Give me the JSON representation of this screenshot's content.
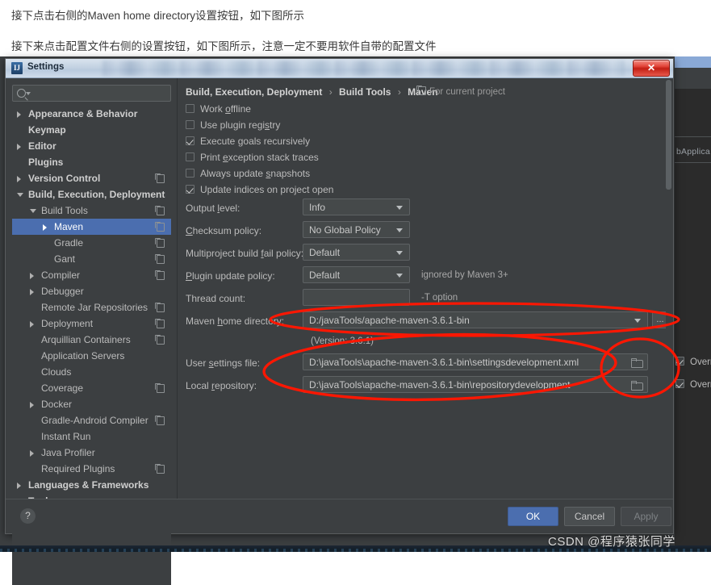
{
  "article": {
    "paragraphs": [
      "接下点击右侧的Maven home directory设置按钮，如下图所示",
      "接下来点击配置文件右侧的设置按钮，如下图所示，注意一定不要用软件自带的配置文件"
    ]
  },
  "window": {
    "title": "Settings",
    "app_icon": "IJ",
    "close_label": "✕"
  },
  "search": {
    "placeholder": "",
    "value": "",
    "icon": "search-icon"
  },
  "tree": {
    "items": [
      {
        "label": "Appearance & Behavior",
        "indent": 0,
        "arrow": "collapsed",
        "bold": true,
        "copy": false,
        "selected": false
      },
      {
        "label": "Keymap",
        "indent": 0,
        "arrow": "none",
        "bold": true,
        "copy": false,
        "selected": false
      },
      {
        "label": "Editor",
        "indent": 0,
        "arrow": "collapsed",
        "bold": true,
        "copy": false,
        "selected": false
      },
      {
        "label": "Plugins",
        "indent": 0,
        "arrow": "none",
        "bold": true,
        "copy": false,
        "selected": false
      },
      {
        "label": "Version Control",
        "indent": 0,
        "arrow": "collapsed",
        "bold": true,
        "copy": true,
        "selected": false
      },
      {
        "label": "Build, Execution, Deployment",
        "indent": 0,
        "arrow": "expanded",
        "bold": true,
        "copy": false,
        "selected": false
      },
      {
        "label": "Build Tools",
        "indent": 1,
        "arrow": "expanded",
        "bold": false,
        "copy": true,
        "selected": false
      },
      {
        "label": "Maven",
        "indent": 2,
        "arrow": "collapsed",
        "bold": false,
        "copy": true,
        "selected": true
      },
      {
        "label": "Gradle",
        "indent": 2,
        "arrow": "none",
        "bold": false,
        "copy": true,
        "selected": false
      },
      {
        "label": "Gant",
        "indent": 2,
        "arrow": "none",
        "bold": false,
        "copy": true,
        "selected": false
      },
      {
        "label": "Compiler",
        "indent": 1,
        "arrow": "collapsed",
        "bold": false,
        "copy": true,
        "selected": false
      },
      {
        "label": "Debugger",
        "indent": 1,
        "arrow": "collapsed",
        "bold": false,
        "copy": false,
        "selected": false
      },
      {
        "label": "Remote Jar Repositories",
        "indent": 1,
        "arrow": "none",
        "bold": false,
        "copy": true,
        "selected": false
      },
      {
        "label": "Deployment",
        "indent": 1,
        "arrow": "collapsed",
        "bold": false,
        "copy": true,
        "selected": false
      },
      {
        "label": "Arquillian Containers",
        "indent": 1,
        "arrow": "none",
        "bold": false,
        "copy": true,
        "selected": false
      },
      {
        "label": "Application Servers",
        "indent": 1,
        "arrow": "none",
        "bold": false,
        "copy": false,
        "selected": false
      },
      {
        "label": "Clouds",
        "indent": 1,
        "arrow": "none",
        "bold": false,
        "copy": false,
        "selected": false
      },
      {
        "label": "Coverage",
        "indent": 1,
        "arrow": "none",
        "bold": false,
        "copy": true,
        "selected": false
      },
      {
        "label": "Docker",
        "indent": 1,
        "arrow": "collapsed",
        "bold": false,
        "copy": false,
        "selected": false
      },
      {
        "label": "Gradle-Android Compiler",
        "indent": 1,
        "arrow": "none",
        "bold": false,
        "copy": true,
        "selected": false
      },
      {
        "label": "Instant Run",
        "indent": 1,
        "arrow": "none",
        "bold": false,
        "copy": false,
        "selected": false
      },
      {
        "label": "Java Profiler",
        "indent": 1,
        "arrow": "collapsed",
        "bold": false,
        "copy": false,
        "selected": false
      },
      {
        "label": "Required Plugins",
        "indent": 1,
        "arrow": "none",
        "bold": false,
        "copy": true,
        "selected": false
      },
      {
        "label": "Languages & Frameworks",
        "indent": 0,
        "arrow": "collapsed",
        "bold": true,
        "copy": false,
        "selected": false
      },
      {
        "label": "Tools",
        "indent": 0,
        "arrow": "collapsed",
        "bold": true,
        "copy": false,
        "selected": false
      }
    ]
  },
  "panel": {
    "breadcrumb": {
      "root": "Build, Execution, Deployment",
      "mid": "Build Tools",
      "leaf": "Maven",
      "separator": "›"
    },
    "for_current_project": "For current project",
    "checkboxes": [
      {
        "label": "Work offline",
        "checked": false
      },
      {
        "label": "Use plugin registry",
        "checked": false
      },
      {
        "label": "Execute goals recursively",
        "checked": true
      },
      {
        "label": "Print exception stack traces",
        "checked": false
      },
      {
        "label": "Always update snapshots",
        "checked": false
      },
      {
        "label": "Update indices on project open",
        "checked": true
      }
    ],
    "fields": {
      "output_level": {
        "label": "Output level:",
        "value": "Info",
        "hint": ""
      },
      "checksum": {
        "label": "Checksum policy:",
        "value": "No Global Policy",
        "hint": ""
      },
      "multiproject": {
        "label": "Multiproject build fail policy:",
        "value": "Default",
        "hint": ""
      },
      "plugin_update": {
        "label": "Plugin update policy:",
        "value": "Default",
        "hint": "ignored by Maven 3+"
      },
      "thread_count": {
        "label": "Thread count:",
        "value": "",
        "hint": "-T option"
      },
      "maven_home": {
        "label": "Maven home directory:",
        "value": "D:/javaTools/apache-maven-3.6.1-bin",
        "browse": "..."
      },
      "maven_version": {
        "text": "(Version: 3.6.1)"
      },
      "user_settings": {
        "label": "User settings file:",
        "value": "D:\\javaTools\\apache-maven-3.6.1-bin\\settingsdevelopment.xml",
        "override_label": "Override",
        "override_checked": true
      },
      "local_repo": {
        "label": "Local repository:",
        "value": "D:\\javaTools\\apache-maven-3.6.1-bin\\repositorydevelopment",
        "override_label": "Override",
        "override_checked": true
      }
    }
  },
  "footer": {
    "help_label": "?",
    "ok_label": "OK",
    "cancel_label": "Cancel",
    "apply_label": "Apply"
  },
  "background": {
    "editor_tab_fragment": "bApplica"
  },
  "watermark": {
    "text": "CSDN @程序猿张同学"
  },
  "colors": {
    "accent": "#4b6eaf",
    "panel_bg": "#3c3f41",
    "field_bg": "#45494a",
    "annotation_red": "#fc1703",
    "text": "#bbbbbb"
  }
}
